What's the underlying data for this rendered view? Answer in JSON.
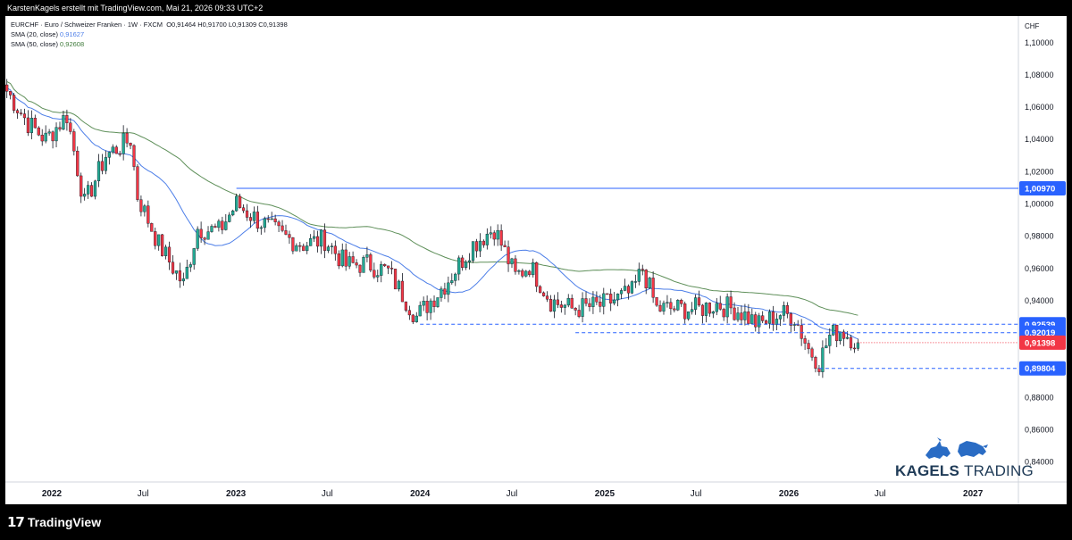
{
  "topbar": {
    "text": "KarstenKagels erstellt mit TradingView.com, Mai 21, 2026 09:33 UTC+2"
  },
  "legend": {
    "symbol": "EURCHF · Euro / Schweizer Franken · 1W · FXCM",
    "ohlc": "O0,91464  H0,91700  L0,91309  C0,91398",
    "sma20_label": "SMA (20, close)",
    "sma20_value": "0,91627",
    "sma50_label": "SMA (50, close)",
    "sma50_value": "0,92608"
  },
  "footer": {
    "logo_mark": "17",
    "logo_text": "TradingView"
  },
  "brand": {
    "name_bold": "KAGELS",
    "name_light": "TRADING"
  },
  "colors": {
    "up": "#22ab94",
    "down": "#f23645",
    "sma20": "#4c7ee8",
    "sma50": "#5e8f59",
    "level": "#2962ff",
    "price": "#f23645"
  },
  "chart_data": {
    "type": "candlestick",
    "ylabel": "CHF",
    "ylim": [
      0.8276,
      1.1165
    ],
    "yticks": [
      "1,10000",
      "1,08000",
      "1,06000",
      "1,04000",
      "1,02000",
      "1,00000",
      "0,98000",
      "0,96000",
      "0,94000",
      "0,92000",
      "0,90000",
      "0,88000",
      "0,86000",
      "0,84000"
    ],
    "xticks": [
      {
        "t": "2022-01-01",
        "label": "2022"
      },
      {
        "t": "2022-07-01",
        "label": "Jul"
      },
      {
        "t": "2023-01-01",
        "label": "2023"
      },
      {
        "t": "2023-07-01",
        "label": "Jul"
      },
      {
        "t": "2024-01-01",
        "label": "2024"
      },
      {
        "t": "2024-07-01",
        "label": "Jul"
      },
      {
        "t": "2025-01-01",
        "label": "2025"
      },
      {
        "t": "2025-07-01",
        "label": "Jul"
      },
      {
        "t": "2026-01-01",
        "label": "2026"
      },
      {
        "t": "2026-07-01",
        "label": "Jul"
      },
      {
        "t": "2027-01-01",
        "label": "2027"
      }
    ],
    "x_start": "2021-10-01",
    "x_end": "2027-04-01",
    "levels": [
      {
        "value": 1.0097,
        "label": "1,00970",
        "from": "2023-01-02",
        "style": "solid"
      },
      {
        "value": 0.92539,
        "label": "0,92539",
        "from": "2024-01-01",
        "style": "dashed"
      },
      {
        "value": 0.92019,
        "label": "0,92019",
        "from": "2024-11-04",
        "style": "dashed"
      },
      {
        "value": 0.89804,
        "label": "0,89804",
        "from": "2026-03-02",
        "style": "dashed"
      }
    ],
    "last_price": {
      "value": 0.91398,
      "label": "0,91398"
    },
    "anchors": [
      [
        "2021-10-04",
        1.07
      ],
      [
        "2021-11-15",
        1.05
      ],
      [
        "2021-12-20",
        1.04
      ],
      [
        "2022-01-31",
        1.055
      ],
      [
        "2022-03-07",
        1.0
      ],
      [
        "2022-04-18",
        1.03
      ],
      [
        "2022-06-06",
        1.04
      ],
      [
        "2022-06-20",
        1.005
      ],
      [
        "2022-08-01",
        0.975
      ],
      [
        "2022-09-19",
        0.95
      ],
      [
        "2022-10-17",
        0.985
      ],
      [
        "2022-11-28",
        0.983
      ],
      [
        "2023-01-02",
        1.0
      ],
      [
        "2023-02-13",
        0.99
      ],
      [
        "2023-04-03",
        0.98
      ],
      [
        "2023-05-15",
        0.975
      ],
      [
        "2023-06-26",
        0.978
      ],
      [
        "2023-08-07",
        0.962
      ],
      [
        "2023-09-18",
        0.963
      ],
      [
        "2023-10-30",
        0.958
      ],
      [
        "2023-12-25",
        0.93
      ],
      [
        "2024-02-19",
        0.95
      ],
      [
        "2024-04-15",
        0.975
      ],
      [
        "2024-05-27",
        0.985
      ],
      [
        "2024-07-08",
        0.955
      ],
      [
        "2024-08-05",
        0.962
      ],
      [
        "2024-09-16",
        0.94
      ],
      [
        "2024-10-28",
        0.935
      ],
      [
        "2024-12-23",
        0.937
      ],
      [
        "2025-02-24",
        0.945
      ],
      [
        "2025-03-17",
        0.96
      ],
      [
        "2025-04-14",
        0.935
      ],
      [
        "2025-05-26",
        0.935
      ],
      [
        "2025-07-07",
        0.935
      ],
      [
        "2025-08-11",
        0.938
      ],
      [
        "2025-09-22",
        0.934
      ],
      [
        "2025-11-03",
        0.925
      ],
      [
        "2025-12-15",
        0.932
      ],
      [
        "2026-01-12",
        0.93
      ],
      [
        "2026-02-09",
        0.91
      ],
      [
        "2026-03-02",
        0.902
      ],
      [
        "2026-03-23",
        0.918
      ],
      [
        "2026-04-13",
        0.922
      ],
      [
        "2026-05-18",
        0.914
      ]
    ]
  }
}
